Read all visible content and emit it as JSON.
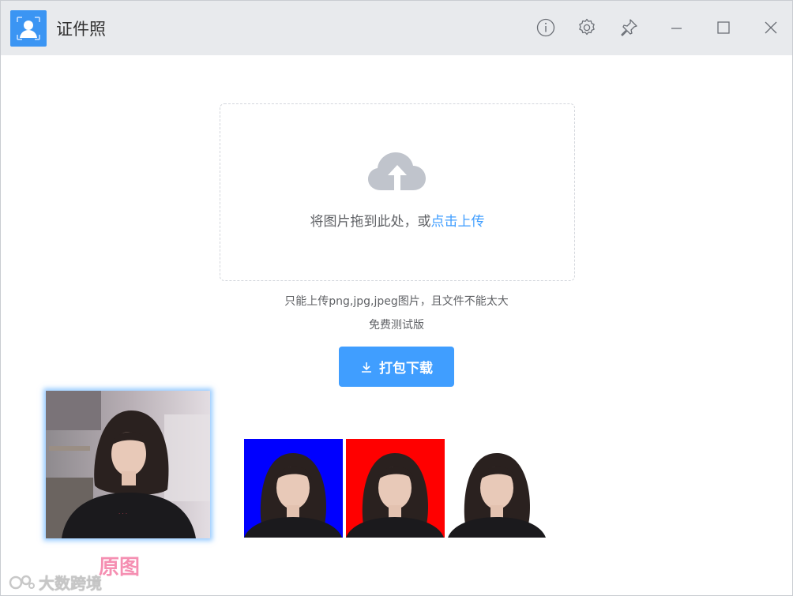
{
  "app": {
    "title": "证件照",
    "logo_icon": "id-photo-logo-icon"
  },
  "titlebar": {
    "buttons": [
      "info-icon",
      "gear-icon",
      "pin-icon",
      "minimize-icon",
      "maximize-icon",
      "close-icon"
    ]
  },
  "upload": {
    "text_prefix": "将图片拖到此处，或",
    "link_text": "点击上传",
    "icon": "cloud-upload-icon"
  },
  "hints": {
    "file_types": "只能上传png,jpg,jpeg图片，且文件不能太大",
    "version": "免费测试版"
  },
  "download_button": {
    "label": "打包下载",
    "icon": "download-icon"
  },
  "photos": {
    "original_label": "原图",
    "backgrounds": [
      "#0000ff",
      "#ff0000",
      "#ffffff"
    ]
  },
  "watermark": {
    "text": "大数跨境"
  },
  "colors": {
    "accent": "#409eff",
    "title_bar": "#e8eaed",
    "label_pink": "#f58fb2"
  }
}
